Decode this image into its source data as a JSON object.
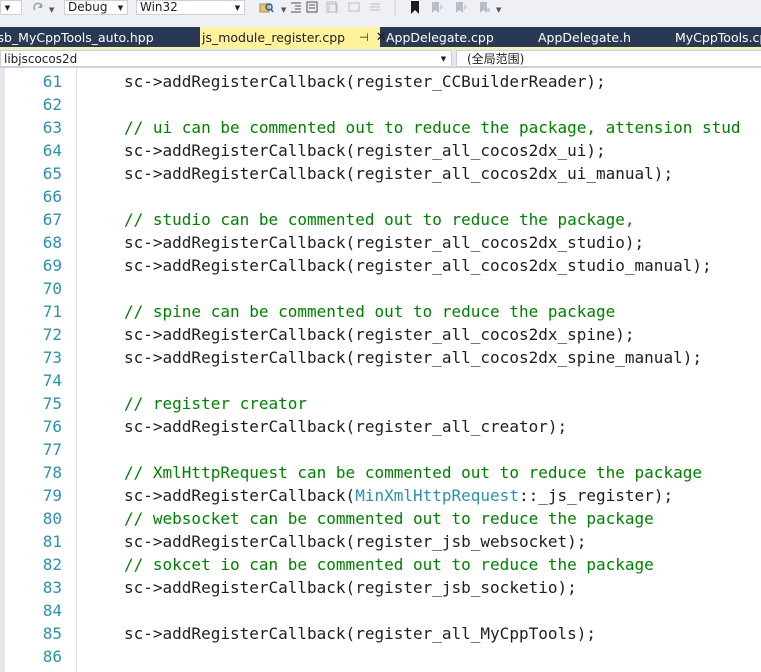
{
  "toolbar": {
    "configuration": "Debug",
    "platform": "Win32",
    "icons": [
      "dropdown-arrow",
      "redo-icon",
      "find-in-files-icon",
      "bookmark-icon"
    ]
  },
  "tabs": [
    {
      "label": "jsb_MyCppTools_auto.hpp",
      "active": false
    },
    {
      "label": "js_module_register.cpp",
      "active": true
    },
    {
      "label": "AppDelegate.cpp",
      "active": false
    },
    {
      "label": "AppDelegate.h",
      "active": false
    },
    {
      "label": "MyCppTools.cpp",
      "active": false
    }
  ],
  "navigation": {
    "project": "libjscocos2d",
    "scope": "(全局范围)"
  },
  "editor": {
    "lines": [
      {
        "number": "61",
        "text": "sc->addRegisterCallback(register_CCBuilderReader);",
        "kind": "code"
      },
      {
        "number": "62",
        "text": "",
        "kind": "blank"
      },
      {
        "number": "63",
        "text": "// ui can be commented out to reduce the package, attension stud",
        "kind": "comment"
      },
      {
        "number": "64",
        "text": "sc->addRegisterCallback(register_all_cocos2dx_ui);",
        "kind": "code"
      },
      {
        "number": "65",
        "text": "sc->addRegisterCallback(register_all_cocos2dx_ui_manual);",
        "kind": "code"
      },
      {
        "number": "66",
        "text": "",
        "kind": "blank"
      },
      {
        "number": "67",
        "text": "// studio can be commented out to reduce the package,",
        "kind": "comment"
      },
      {
        "number": "68",
        "text": "sc->addRegisterCallback(register_all_cocos2dx_studio);",
        "kind": "code"
      },
      {
        "number": "69",
        "text": "sc->addRegisterCallback(register_all_cocos2dx_studio_manual);",
        "kind": "code"
      },
      {
        "number": "70",
        "text": "",
        "kind": "blank"
      },
      {
        "number": "71",
        "text": "// spine can be commented out to reduce the package",
        "kind": "comment"
      },
      {
        "number": "72",
        "text": "sc->addRegisterCallback(register_all_cocos2dx_spine);",
        "kind": "code"
      },
      {
        "number": "73",
        "text": "sc->addRegisterCallback(register_all_cocos2dx_spine_manual);",
        "kind": "code"
      },
      {
        "number": "74",
        "text": "",
        "kind": "blank"
      },
      {
        "number": "75",
        "text": "// register creator",
        "kind": "comment"
      },
      {
        "number": "76",
        "text": "sc->addRegisterCallback(register_all_creator);",
        "kind": "code"
      },
      {
        "number": "77",
        "text": "",
        "kind": "blank"
      },
      {
        "number": "78",
        "text": "// XmlHttpRequest can be commented out to reduce the package",
        "kind": "comment"
      },
      {
        "number": "79",
        "kind": "typed",
        "before": "sc->addRegisterCallback(",
        "type": "MinXmlHttpRequest",
        "after": "::_js_register);"
      },
      {
        "number": "80",
        "text": "// websocket can be commented out to reduce the package",
        "kind": "comment"
      },
      {
        "number": "81",
        "text": "sc->addRegisterCallback(register_jsb_websocket);",
        "kind": "code"
      },
      {
        "number": "82",
        "text": "// sokcet io can be commented out to reduce the package",
        "kind": "comment"
      },
      {
        "number": "83",
        "text": "sc->addRegisterCallback(register_jsb_socketio);",
        "kind": "code"
      },
      {
        "number": "84",
        "text": "",
        "kind": "blank"
      },
      {
        "number": "85",
        "text": "sc->addRegisterCallback(register_all_MyCppTools);",
        "kind": "code"
      },
      {
        "number": "86",
        "text": "",
        "kind": "blank"
      }
    ]
  },
  "colors": {
    "tab_bar": "#293955",
    "active_tab": "#fff29d",
    "line_number": "#2b91af",
    "comment": "#008000",
    "type_name": "#2b91af",
    "code_text": "#1e1e1e"
  }
}
